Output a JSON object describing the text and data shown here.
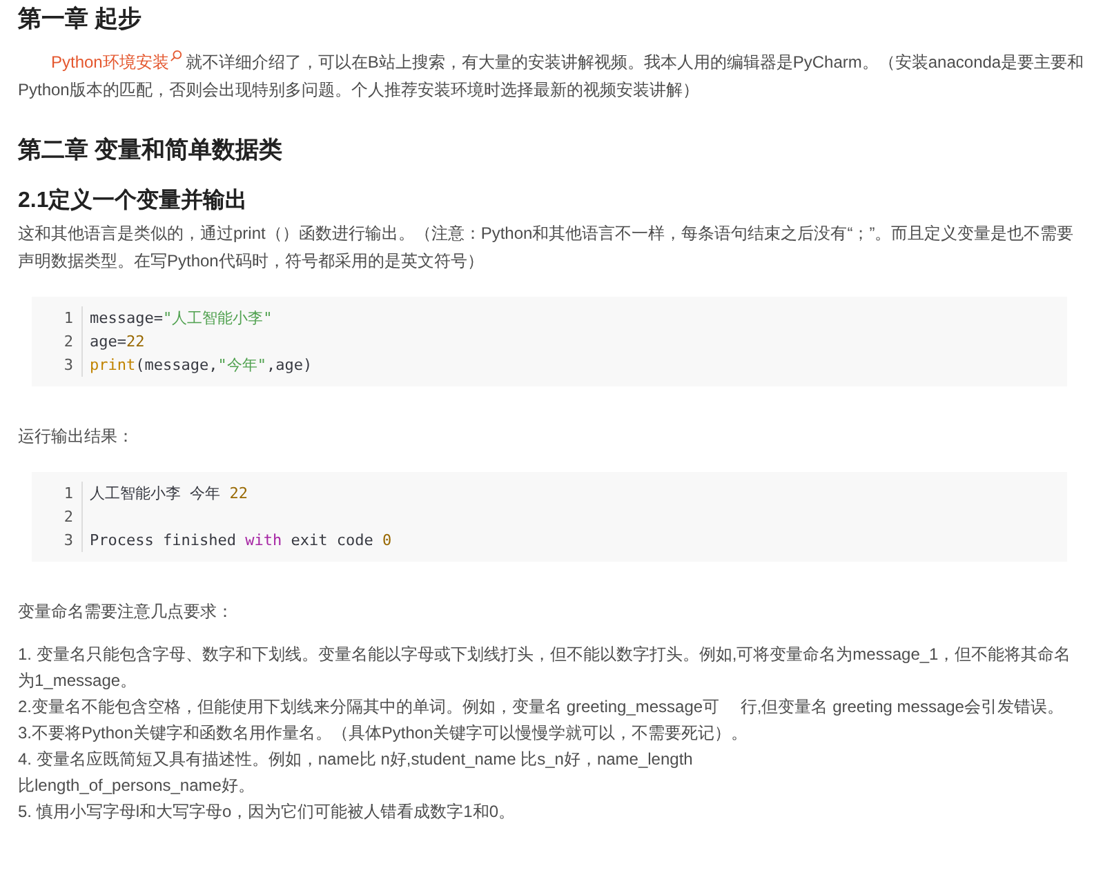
{
  "blocks": [
    {
      "kind": "h2",
      "text": "第一章 起步"
    },
    {
      "kind": "intro",
      "link": "Python环境安装",
      "text": "就不详细介绍了，可以在B站上搜索，有大量的安装讲解视频。我本人用的编辑器是PyCharm。（安装anaconda是要主要和Python版本的匹配，否则会出现特别多问题。个人推荐安装环境时选择最新的视频安装讲解）"
    },
    {
      "kind": "h2",
      "text": "第二章 变量和简单数据类"
    },
    {
      "kind": "h3",
      "text": "2.1定义一个变量并输出"
    },
    {
      "kind": "p",
      "text": "这和其他语言是类似的，通过print（）函数进行输出。（注意：Python和其他语言不一样，每条语句结束之后没有“；”。而且定义变量是也不需要声明数据类型。在写Python代码时，符号都采用的是英文符号）"
    },
    {
      "kind": "code",
      "lines": [
        {
          "number": "1",
          "tokens": [
            {
              "kind": "plain",
              "text": "message="
            },
            {
              "kind": "string",
              "text": "\"人工智能小李\""
            }
          ]
        },
        {
          "number": "2",
          "tokens": [
            {
              "kind": "plain",
              "text": "age="
            },
            {
              "kind": "number",
              "text": "22"
            }
          ]
        },
        {
          "number": "3",
          "tokens": [
            {
              "kind": "builtin",
              "text": "print"
            },
            {
              "kind": "plain",
              "text": "(message,"
            },
            {
              "kind": "string",
              "text": "\"今年\""
            },
            {
              "kind": "plain",
              "text": ",age)"
            }
          ]
        }
      ]
    },
    {
      "kind": "p",
      "text": "运行输出结果："
    },
    {
      "kind": "code",
      "lines": [
        {
          "number": "1",
          "tokens": [
            {
              "kind": "plain",
              "text": "人工智能小李 今年 "
            },
            {
              "kind": "number",
              "text": "22"
            }
          ]
        },
        {
          "number": "2"
        },
        {
          "number": "3",
          "tokens": [
            {
              "kind": "plain",
              "text": "Process finished "
            },
            {
              "kind": "keyword",
              "text": "with"
            },
            {
              "kind": "plain",
              "text": " exit code "
            },
            {
              "kind": "number",
              "text": "0"
            }
          ]
        }
      ]
    },
    {
      "kind": "p",
      "text": "变量命名需要注意几点要求："
    },
    {
      "kind": "list",
      "items": [
        {
          "lines": [
            "1. 变量名只能包含字母、数字和下划线。变量名能以字母或下划线打头，但不能以数字打头。例如,可将变量命名为message_1，但不能将其命名为1_message。"
          ]
        },
        {
          "lines": [
            "2.变量名不能包含空格，但能使用下划线来分隔其中的单词。例如，变量名 greeting_message可　 行,但变量名 greeting message会引发错误。"
          ]
        },
        {
          "lines": [
            "3.不要将Python关键字和函数名用作量名。（具体Python关键字可以慢慢学就可以，不需要死记）。"
          ]
        },
        {
          "lines": [
            "4. 变量名应既简短又具有描述性。例如，name比 n好,student_name 比s_n好，name_length",
            "比length_of_persons_name好。"
          ]
        },
        {
          "lines": [
            "5. 慎用小写字母l和大写字母o，因为它们可能被人错看成数字1和0。"
          ]
        }
      ]
    }
  ]
}
